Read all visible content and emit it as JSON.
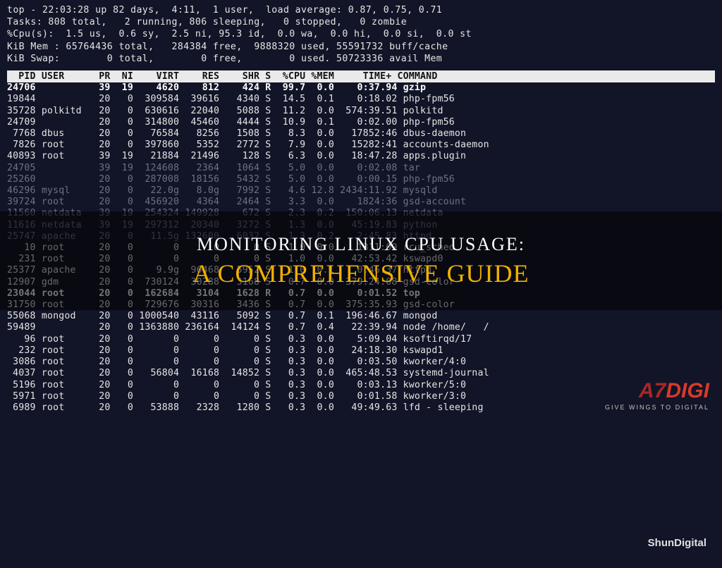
{
  "summary": {
    "line1": "top - 22:03:28 up 82 days,  4:11,  1 user,  load average: 0.87, 0.75, 0.71",
    "line2": "Tasks: 808 total,   2 running, 806 sleeping,   0 stopped,   0 zombie",
    "line3": "%Cpu(s):  1.5 us,  0.6 sy,  2.5 ni, 95.3 id,  0.0 wa,  0.0 hi,  0.0 si,  0.0 st",
    "line4": "KiB Mem : 65764436 total,   284384 free,  9888320 used, 55591732 buff/cache",
    "line5": "KiB Swap:        0 total,        0 free,        0 used. 50723336 avail Mem"
  },
  "header": "  PID USER      PR  NI    VIRT    RES    SHR S  %CPU %MEM     TIME+ COMMAND           ",
  "processes": [
    {
      "bold": true,
      "dim": false,
      "pid": "24706",
      "user": "        ",
      "pr": "39",
      "ni": "19",
      "virt": "4620",
      "res": "812",
      "shr": "424",
      "s": "R",
      "cpu": "99.7",
      "mem": "0.0",
      "time": "0:37.94",
      "cmd": "gzip"
    },
    {
      "bold": false,
      "dim": false,
      "pid": "19844",
      "user": "        ",
      "pr": "20",
      "ni": "0",
      "virt": "309584",
      "res": "39616",
      "shr": "4340",
      "s": "S",
      "cpu": "14.5",
      "mem": "0.1",
      "time": "0:18.02",
      "cmd": "php-fpm56"
    },
    {
      "bold": false,
      "dim": false,
      "pid": "35728",
      "user": "polkitd ",
      "pr": "20",
      "ni": "0",
      "virt": "630616",
      "res": "22040",
      "shr": "5088",
      "s": "S",
      "cpu": "11.2",
      "mem": "0.0",
      "time": "574:39.51",
      "cmd": "polkitd"
    },
    {
      "bold": false,
      "dim": false,
      "pid": "24709",
      "user": "        ",
      "pr": "20",
      "ni": "0",
      "virt": "314800",
      "res": "45460",
      "shr": "4444",
      "s": "S",
      "cpu": "10.9",
      "mem": "0.1",
      "time": "0:02.00",
      "cmd": "php-fpm56"
    },
    {
      "bold": false,
      "dim": false,
      "pid": " 7768",
      "user": "dbus    ",
      "pr": "20",
      "ni": "0",
      "virt": "76584",
      "res": "8256",
      "shr": "1508",
      "s": "S",
      "cpu": "8.3",
      "mem": "0.0",
      "time": "17852:46",
      "cmd": "dbus-daemon"
    },
    {
      "bold": false,
      "dim": false,
      "pid": " 7826",
      "user": "root    ",
      "pr": "20",
      "ni": "0",
      "virt": "397860",
      "res": "5352",
      "shr": "2772",
      "s": "S",
      "cpu": "7.9",
      "mem": "0.0",
      "time": "15282:41",
      "cmd": "accounts-daemon"
    },
    {
      "bold": false,
      "dim": false,
      "pid": "40893",
      "user": "root    ",
      "pr": "39",
      "ni": "19",
      "virt": "21884",
      "res": "21496",
      "shr": "128",
      "s": "S",
      "cpu": "6.3",
      "mem": "0.0",
      "time": "18:47.28",
      "cmd": "apps.plugin"
    },
    {
      "bold": false,
      "dim": true,
      "pid": "24705",
      "user": "        ",
      "pr": "39",
      "ni": "19",
      "virt": "124608",
      "res": "2364",
      "shr": "1064",
      "s": "S",
      "cpu": "5.0",
      "mem": "0.0",
      "time": "0:02.08",
      "cmd": "tar"
    },
    {
      "bold": false,
      "dim": true,
      "pid": "25260",
      "user": "        ",
      "pr": "20",
      "ni": "0",
      "virt": "287008",
      "res": "18156",
      "shr": "5432",
      "s": "S",
      "cpu": "5.0",
      "mem": "0.0",
      "time": "0:00.15",
      "cmd": "php-fpm56"
    },
    {
      "bold": false,
      "dim": true,
      "pid": "46296",
      "user": "mysql   ",
      "pr": "20",
      "ni": "0",
      "virt": "22.0g",
      "res": "8.0g",
      "shr": "7992",
      "s": "S",
      "cpu": "4.6",
      "mem": "12.8",
      "time": "2434:11.92",
      "cmd": "mysqld"
    },
    {
      "bold": false,
      "dim": true,
      "pid": "39724",
      "user": "root    ",
      "pr": "20",
      "ni": "0",
      "virt": "456920",
      "res": "4364",
      "shr": "2464",
      "s": "S",
      "cpu": "3.3",
      "mem": "0.0",
      "time": "1824:36",
      "cmd": "gsd-account"
    },
    {
      "bold": false,
      "dim": true,
      "pid": "11560",
      "user": "netdata ",
      "pr": "39",
      "ni": "19",
      "virt": "254324",
      "res": "149928",
      "shr": "672",
      "s": "S",
      "cpu": "2.3",
      "mem": "0.2",
      "time": "150:06.13",
      "cmd": "netdata"
    },
    {
      "bold": false,
      "dim": true,
      "pid": "11616",
      "user": "netdata ",
      "pr": "39",
      "ni": "19",
      "virt": "297312",
      "res": "20340",
      "shr": "3272",
      "s": "S",
      "cpu": "1.3",
      "mem": "0.0",
      "time": "45:19.83",
      "cmd": "python"
    },
    {
      "bold": false,
      "dim": true,
      "pid": "25747",
      "user": "apache  ",
      "pr": "20",
      "ni": "0",
      "virt": "11.5g",
      "res": "132600",
      "shr": "6032",
      "s": "S",
      "cpu": "1.3",
      "mem": "0.2",
      "time": "2:45.83",
      "cmd": "httpd"
    },
    {
      "bold": false,
      "dim": false,
      "pid": "   10",
      "user": "root    ",
      "pr": "20",
      "ni": "0",
      "virt": "0",
      "res": "0",
      "shr": "0",
      "s": "S",
      "cpu": "1.0",
      "mem": "0.0",
      "time": "1311:09",
      "cmd": "rcu_sched"
    },
    {
      "bold": false,
      "dim": false,
      "pid": "  231",
      "user": "root    ",
      "pr": "20",
      "ni": "0",
      "virt": "0",
      "res": "0",
      "shr": "0",
      "s": "S",
      "cpu": "1.0",
      "mem": "0.0",
      "time": "42:53.42",
      "cmd": "kswapd0"
    },
    {
      "bold": false,
      "dim": false,
      "pid": "25377",
      "user": "apache  ",
      "pr": "20",
      "ni": "0",
      "virt": "9.9g",
      "res": "96468",
      "shr": "5952",
      "s": "S",
      "cpu": "1.0",
      "mem": "0.1",
      "time": "0:46.37",
      "cmd": "httpd"
    },
    {
      "bold": false,
      "dim": false,
      "pid": "12907",
      "user": "gdm     ",
      "pr": "20",
      "ni": "0",
      "virt": "730124",
      "res": "30288",
      "shr": "3168",
      "s": "S",
      "cpu": "0.7",
      "mem": "0.0",
      "time": "379:24.08",
      "cmd": "gsd-color"
    },
    {
      "bold": true,
      "dim": false,
      "pid": "23044",
      "user": "root    ",
      "pr": "20",
      "ni": "0",
      "virt": "162684",
      "res": "3104",
      "shr": "1628",
      "s": "R",
      "cpu": "0.7",
      "mem": "0.0",
      "time": "0:01.52",
      "cmd": "top"
    },
    {
      "bold": false,
      "dim": false,
      "pid": "31750",
      "user": "root    ",
      "pr": "20",
      "ni": "0",
      "virt": "729676",
      "res": "30316",
      "shr": "3436",
      "s": "S",
      "cpu": "0.7",
      "mem": "0.0",
      "time": "375:35.93",
      "cmd": "gsd-color"
    },
    {
      "bold": false,
      "dim": false,
      "pid": "55068",
      "user": "mongod  ",
      "pr": "20",
      "ni": "0",
      "virt": "1000540",
      "res": "43116",
      "shr": "5092",
      "s": "S",
      "cpu": "0.7",
      "mem": "0.1",
      "time": "196:46.67",
      "cmd": "mongod"
    },
    {
      "bold": false,
      "dim": false,
      "pid": "59489",
      "user": "        ",
      "pr": "20",
      "ni": "0",
      "virt": "1363880",
      "res": "236164",
      "shr": "14124",
      "s": "S",
      "cpu": "0.7",
      "mem": "0.4",
      "time": "22:39.94",
      "cmd": "node /home/   /"
    },
    {
      "bold": false,
      "dim": false,
      "pid": "   96",
      "user": "root    ",
      "pr": "20",
      "ni": "0",
      "virt": "0",
      "res": "0",
      "shr": "0",
      "s": "S",
      "cpu": "0.3",
      "mem": "0.0",
      "time": "5:09.04",
      "cmd": "ksoftirqd/17"
    },
    {
      "bold": false,
      "dim": false,
      "pid": "  232",
      "user": "root    ",
      "pr": "20",
      "ni": "0",
      "virt": "0",
      "res": "0",
      "shr": "0",
      "s": "S",
      "cpu": "0.3",
      "mem": "0.0",
      "time": "24:18.30",
      "cmd": "kswapd1"
    },
    {
      "bold": false,
      "dim": false,
      "pid": " 3086",
      "user": "root    ",
      "pr": "20",
      "ni": "0",
      "virt": "0",
      "res": "0",
      "shr": "0",
      "s": "S",
      "cpu": "0.3",
      "mem": "0.0",
      "time": "0:03.50",
      "cmd": "kworker/4:0"
    },
    {
      "bold": false,
      "dim": false,
      "pid": " 4037",
      "user": "root    ",
      "pr": "20",
      "ni": "0",
      "virt": "56804",
      "res": "16168",
      "shr": "14852",
      "s": "S",
      "cpu": "0.3",
      "mem": "0.0",
      "time": "465:48.53",
      "cmd": "systemd-journal"
    },
    {
      "bold": false,
      "dim": false,
      "pid": " 5196",
      "user": "root    ",
      "pr": "20",
      "ni": "0",
      "virt": "0",
      "res": "0",
      "shr": "0",
      "s": "S",
      "cpu": "0.3",
      "mem": "0.0",
      "time": "0:03.13",
      "cmd": "kworker/5:0"
    },
    {
      "bold": false,
      "dim": false,
      "pid": " 5971",
      "user": "root    ",
      "pr": "20",
      "ni": "0",
      "virt": "0",
      "res": "0",
      "shr": "0",
      "s": "S",
      "cpu": "0.3",
      "mem": "0.0",
      "time": "0:01.58",
      "cmd": "kworker/3:0"
    },
    {
      "bold": false,
      "dim": false,
      "pid": " 6989",
      "user": "root    ",
      "pr": "20",
      "ni": "0",
      "virt": "53888",
      "res": "2328",
      "shr": "1280",
      "s": "S",
      "cpu": "0.3",
      "mem": "0.0",
      "time": "49:49.63",
      "cmd": "lfd - sleeping"
    }
  ],
  "overlay": {
    "line1": "MONITORING LINUX CPU USAGE:",
    "line2": "A COMPREHENSIVE GUIDE"
  },
  "watermark": {
    "brand_a7": "A7",
    "brand_digi": "DIGI",
    "sub": "GIVE WINGS TO DIGITAL",
    "small": "ShunDigital"
  }
}
